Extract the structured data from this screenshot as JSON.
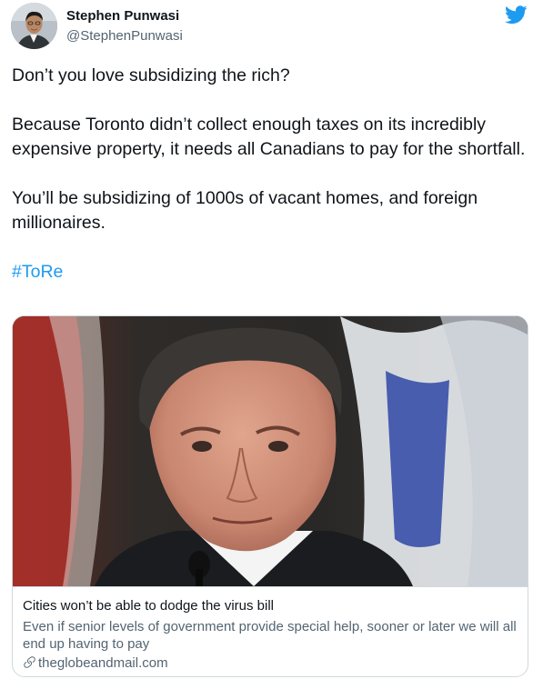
{
  "author": {
    "name": "Stephen Punwasi",
    "handle": "@StephenPunwasi"
  },
  "tweet": {
    "paragraphs": [
      "Don’t you love subsidizing the rich?",
      "Because Toronto didn’t collect enough taxes on its incredibly expensive property, it needs all Canadians to pay for the shortfall.",
      "You’ll be subsidizing of 1000s of vacant homes, and foreign millionaires."
    ],
    "hashtag": "#ToRe"
  },
  "card": {
    "title": "Cities won’t be able to dodge the virus bill",
    "description": "Even if senior levels of government provide special help, sooner or later we will all end up having to pay",
    "domain": "theglobeandmail.com"
  },
  "icons": {
    "brand": "twitter-bird-icon",
    "link": "link-icon"
  },
  "colors": {
    "brand_blue": "#1d9bf0",
    "text": "#0f1419",
    "secondary_text": "#536471",
    "border": "#cfd9de"
  }
}
